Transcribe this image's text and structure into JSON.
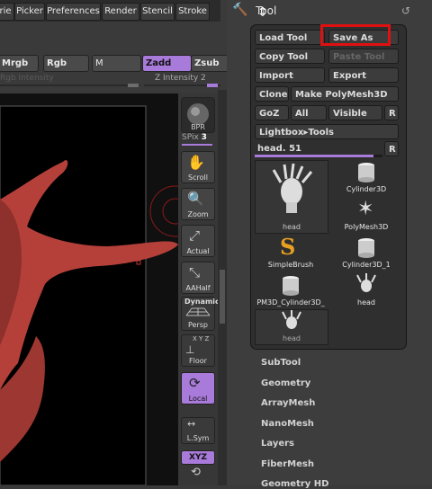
{
  "menubar": {
    "items": [
      "rie",
      "Picker",
      "Preferences",
      "Render",
      "Stencil",
      "Stroke"
    ]
  },
  "brushrow": {
    "mrgb": "Mrgb",
    "rgb": "Rgb",
    "m": "M",
    "zadd": "Zadd",
    "zsub": "Zsub",
    "rgb_intensity": "Rgb Intensity",
    "z_intensity": "Z Intensity 2"
  },
  "shelf": {
    "bpr": "BPR",
    "spix_label": "SPix",
    "spix_value": "3",
    "scroll": "Scroll",
    "zoom": "Zoom",
    "actual": "Actual",
    "aahalf": "AAHalf",
    "dynamic": "Dynamic",
    "persp": "Persp",
    "floor": "Floor",
    "floor_axes": "X Y Z",
    "local": "Local",
    "lsym": "L.Sym",
    "xyz": "XYZ"
  },
  "toolpanel": {
    "title": "Tool",
    "load_tool": "Load Tool",
    "save_as": "Save As",
    "copy_tool": "Copy Tool",
    "paste_tool": "Paste Tool",
    "import": "Import",
    "export": "Export",
    "clone": "Clone",
    "make_polymesh": "Make PolyMesh3D",
    "goz": "GoZ",
    "all": "All",
    "visible": "Visible",
    "r": "R",
    "lightbox_tools": "Lightbox▸Tools",
    "current_tool": "head. 51",
    "slider_value": 0.93,
    "thumbs": [
      "head",
      "Cylinder3D",
      "PolyMesh3D",
      "SimpleBrush",
      "Cylinder3D_1",
      "PM3D_Cylinder3D_",
      "head",
      "head"
    ],
    "subpalettes": [
      "SubTool",
      "Geometry",
      "ArrayMesh",
      "NanoMesh",
      "Layers",
      "FiberMesh",
      "Geometry HD"
    ]
  },
  "colors": {
    "accent": "#a87ad9",
    "highlight_box": "#e01010",
    "model": "#b5403a"
  }
}
